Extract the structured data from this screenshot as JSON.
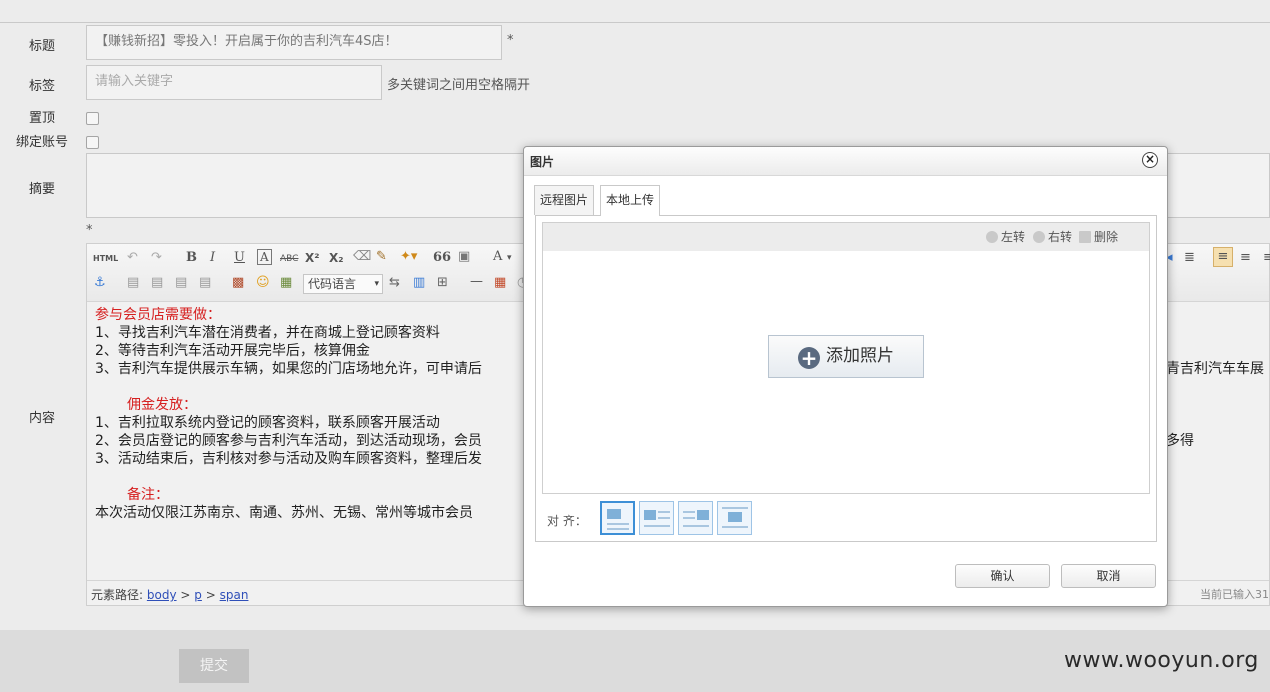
{
  "form": {
    "title_label": "标题",
    "title_value": "【赚钱新招】零投入！开启属于你的吉利汽车4S店！",
    "required_mark": "*",
    "tags_label": "标签",
    "tags_placeholder": "请输入关键字",
    "tags_hint": "多关键词之间用空格隔开",
    "pin_label": "置顶",
    "bind_label": "绑定账号",
    "summary_label": "摘要",
    "content_label": "内容"
  },
  "toolbar": {
    "html_label": "HTML",
    "bold": "B",
    "italic": "I",
    "underline": "U",
    "font_border": "A",
    "strike": "ABC",
    "superscript": "X²",
    "subscript": "X₂",
    "quote": "66",
    "font_color": "A",
    "code_language": "代码语言",
    "hr": "—"
  },
  "content": {
    "line1": "参与会员店需要做：",
    "line2": "1、寻找吉利汽车潜在消费者，并在商城上登记顾客资料",
    "line3": "2、等待吉利汽车活动开展完毕后，核算佣金",
    "line4": "3、吉利汽车提供展示车辆，如果您的门店场地允许，可申请后",
    "line4_tail": "青吉利汽车车展",
    "line5": "佣金发放：",
    "line6": "1、吉利拉取系统内登记的顾客资料，联系顾客开展活动",
    "line7": "2、会员店登记的顾客参与吉利汽车活动，到达活动现场，会员",
    "line7_tail": "多得",
    "line8": "3、活动结束后，吉利核对参与活动及购车顾客资料，整理后发",
    "line9": "备注：",
    "line10": "本次活动仅限江苏南京、南通、苏州、无锡、常州等城市会员"
  },
  "statusbar": {
    "path_label": "元素路径:",
    "p1": "body",
    "sep": ">",
    "p2": "p",
    "p3": "span",
    "count": "当前已输入31"
  },
  "dialog": {
    "title": "图片",
    "close": "×",
    "tab_remote": "远程图片",
    "tab_local": "本地上传",
    "rotate_left": "左转",
    "rotate_right": "右转",
    "delete": "删除",
    "add_photo": "添加照片",
    "align_label": "对 齐：",
    "confirm": "确认",
    "cancel": "取消"
  },
  "submit_label": "提交",
  "watermark": "www.wooyun.org"
}
